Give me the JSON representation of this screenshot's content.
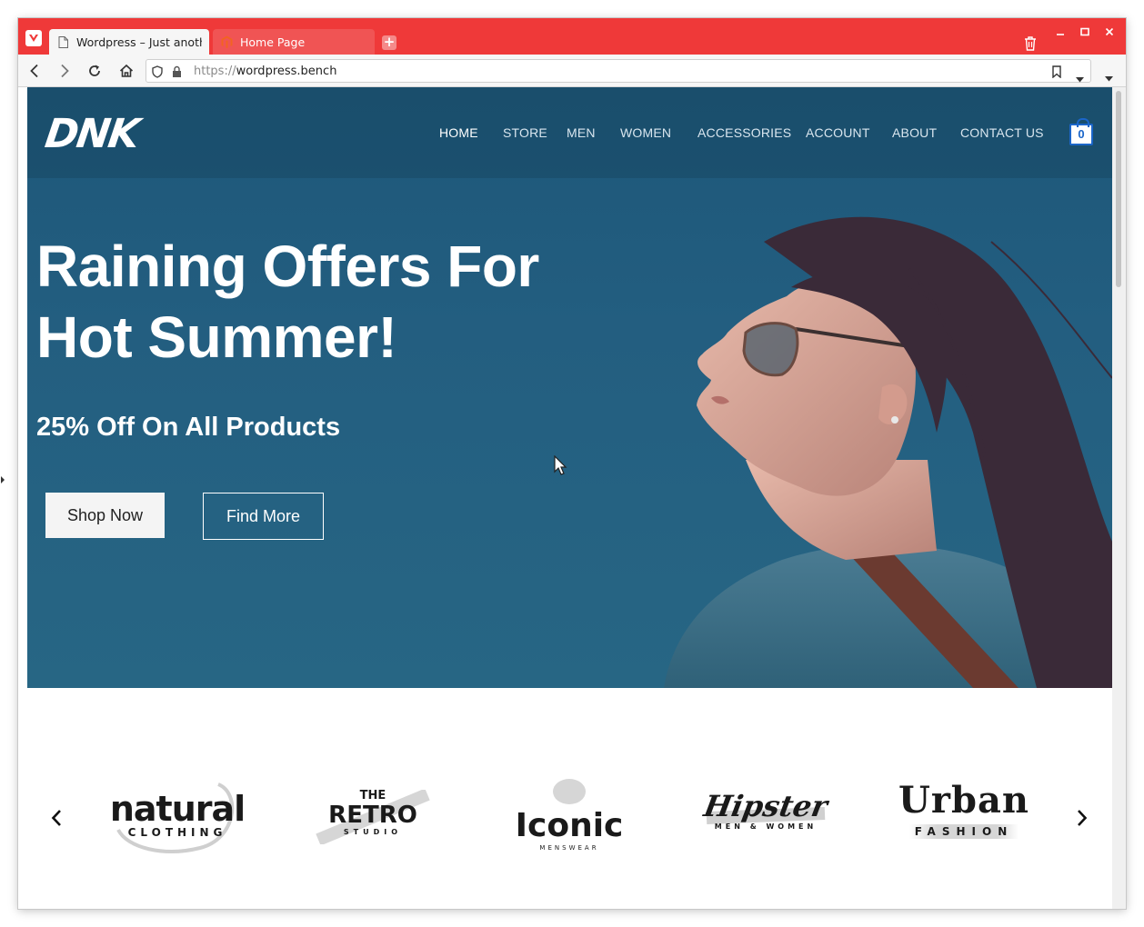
{
  "browser": {
    "tabs": [
      {
        "label": "Wordpress – Just another WordPress site",
        "active": true
      },
      {
        "label": "Home Page",
        "active": false
      }
    ],
    "url_protocol": "https://",
    "url_host": "wordpress.bench",
    "accent_color": "#ef3939"
  },
  "site": {
    "logo": "DNK",
    "menu": [
      "HOME",
      "STORE",
      "MEN",
      "WOMEN",
      "ACCESSORIES",
      "ACCOUNT",
      "ABOUT",
      "CONTACT US"
    ],
    "cart_count": "0",
    "hero": {
      "title_line1": "Raining Offers For",
      "title_line2": "Hot Summer!",
      "subtitle": "25% Off On All Products",
      "primary_button": "Shop Now",
      "secondary_button": "Find More",
      "background_color": "#1d5779"
    },
    "brands": [
      {
        "name": "natural",
        "tagline": "CLOTHING"
      },
      {
        "name": "RETRO",
        "prefix": "THE",
        "tagline": "STUDIO"
      },
      {
        "name": "Iconic",
        "tagline": "MENSWEAR"
      },
      {
        "name": "Hipster",
        "tagline": "MEN & WOMEN"
      },
      {
        "name": "Urban",
        "tagline": "FASHION"
      }
    ]
  }
}
